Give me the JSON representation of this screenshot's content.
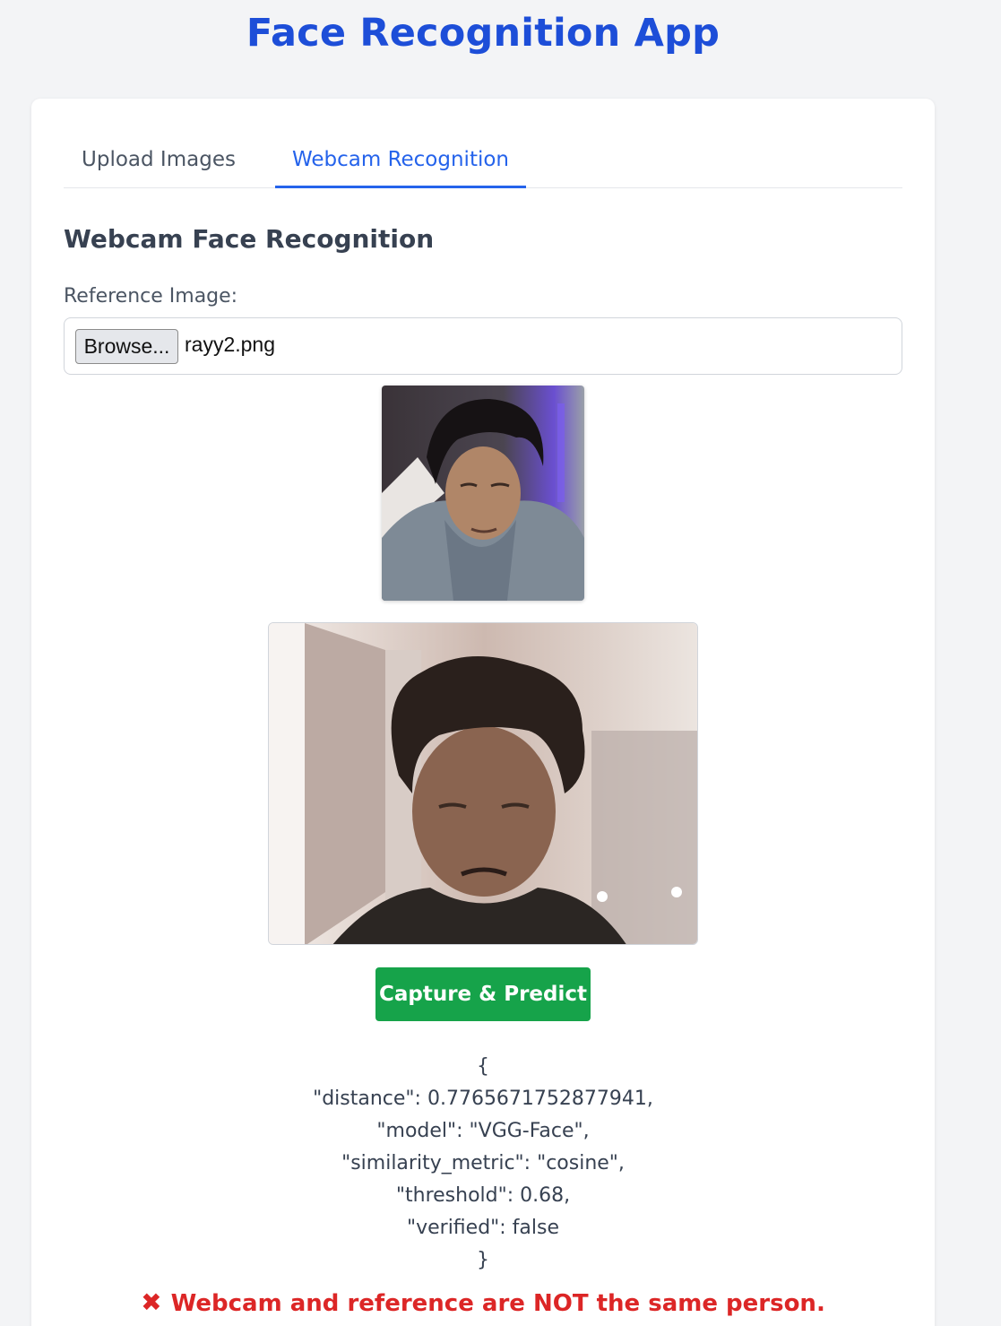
{
  "app": {
    "title": "Face Recognition App"
  },
  "tabs": [
    {
      "label": "Upload Images"
    },
    {
      "label": "Webcam Recognition"
    }
  ],
  "webcam_section": {
    "title": "Webcam Face Recognition",
    "reference_label": "Reference Image:",
    "browse_label": "Browse...",
    "file_name": "rayy2.png",
    "capture_label": "Capture & Predict"
  },
  "result": {
    "lines": [
      "{",
      "\"distance\": 0.7765671752877941,",
      "\"model\": \"VGG-Face\",",
      "\"similarity_metric\": \"cosine\",",
      "\"threshold\": 0.68,",
      "\"verified\": false",
      "}"
    ],
    "verdict_icon": "cross-mark-icon",
    "verdict_text": "Webcam and reference are NOT the same person."
  },
  "colors": {
    "accent": "#2563eb",
    "title": "#1d4ed8",
    "capture_button": "#16a34a",
    "error": "#dc2626"
  }
}
